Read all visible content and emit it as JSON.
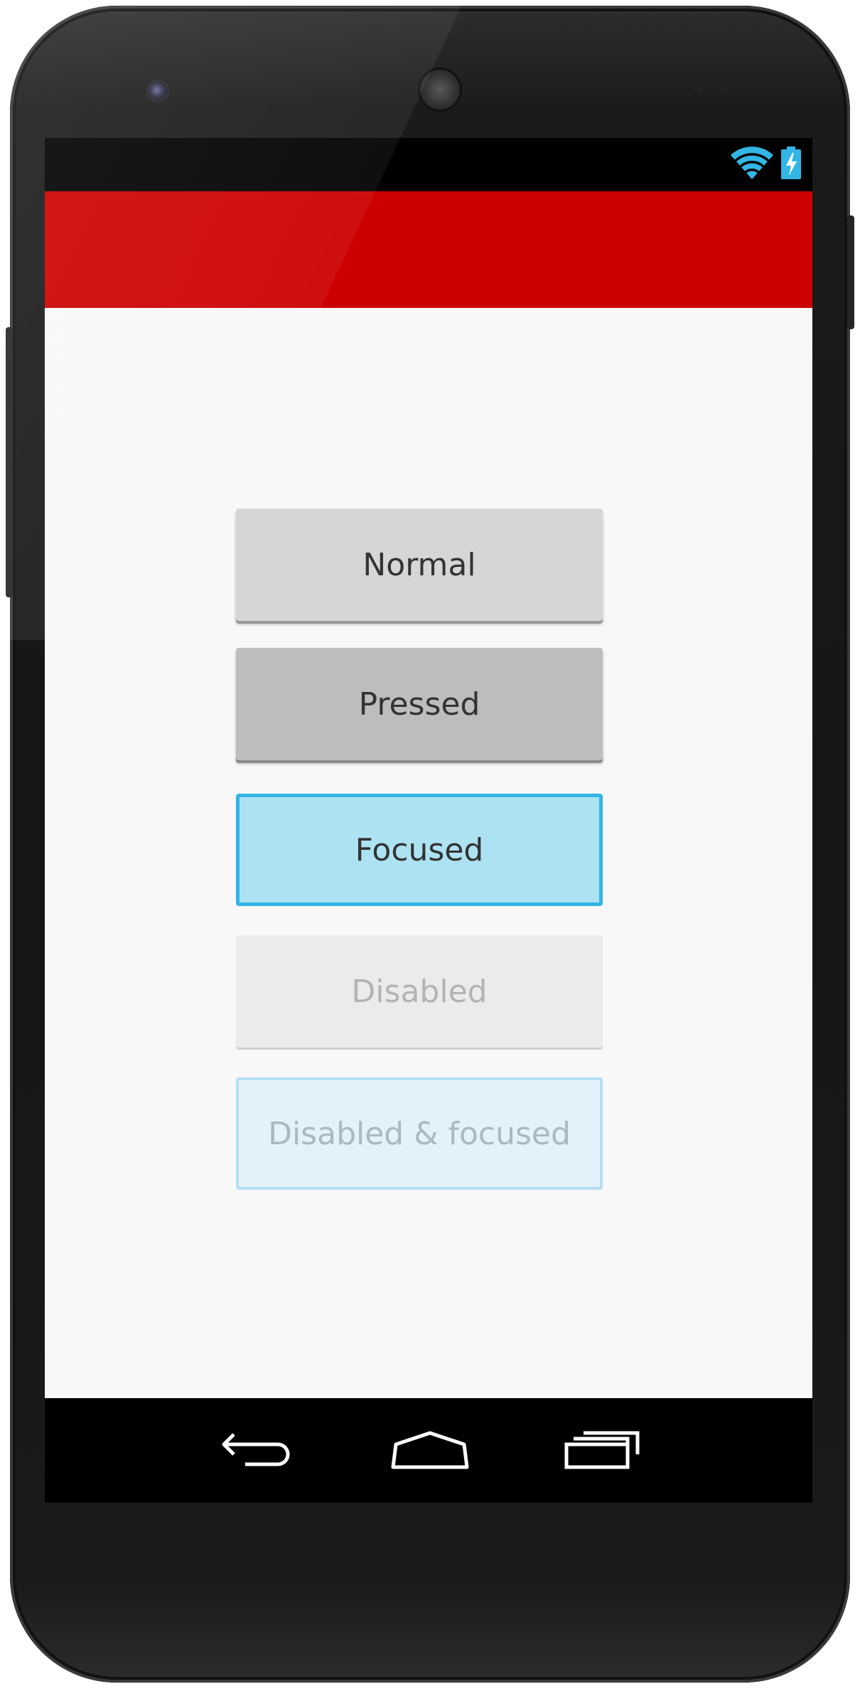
{
  "device": {
    "model": "Nexus 5"
  },
  "status_bar": {
    "icons": [
      "wifi-icon",
      "battery-charging-icon"
    ],
    "accent_color": "#33b5e5"
  },
  "action_bar": {
    "color": "#cc0000"
  },
  "buttons": [
    {
      "label": "Normal",
      "state": "normal"
    },
    {
      "label": "Pressed",
      "state": "pressed"
    },
    {
      "label": "Focused",
      "state": "focused"
    },
    {
      "label": "Disabled",
      "state": "disabled"
    },
    {
      "label": "Disabled & focused",
      "state": "disabled-focused"
    }
  ],
  "nav_bar": {
    "icons": [
      "back-icon",
      "home-icon",
      "recents-icon"
    ]
  }
}
